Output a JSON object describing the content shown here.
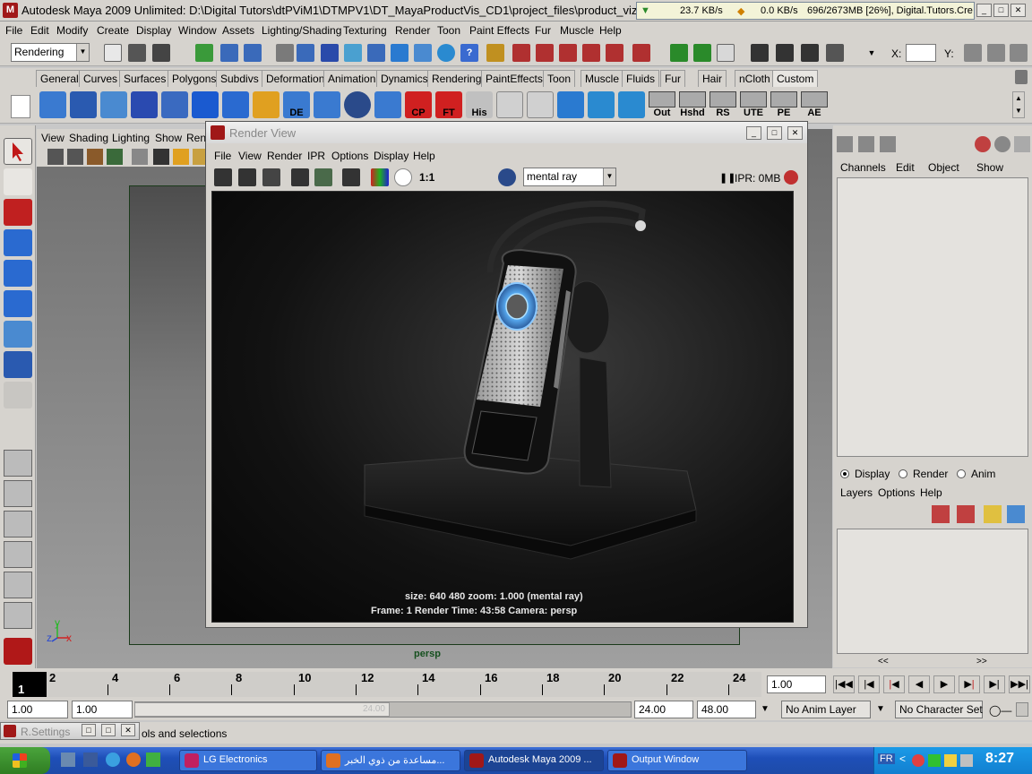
{
  "window": {
    "title": "Autodesk Maya 2009 Unlimited: D:\\Digital Tutors\\dtPViM1\\DTMPV1\\DT_MayaProductVis_CD1\\project_files\\product_viz_proj\\s",
    "net_down": "23.7 KB/s",
    "net_up": "0.0 KB/s",
    "net_info": "696/2673MB [26%], Digital.Tutors.Cre"
  },
  "menubar": [
    "File",
    "Edit",
    "Modify",
    "Create",
    "Display",
    "Window",
    "Assets",
    "Lighting/Shading",
    "Texturing",
    "Render",
    "Toon",
    "Paint Effects",
    "Fur",
    "Muscle",
    "Help"
  ],
  "statusline": {
    "menuset": "Rendering",
    "x_label": "X:",
    "y_label": "Y:"
  },
  "shelf_tabs": [
    "General",
    "Curves",
    "Surfaces",
    "Polygons",
    "Subdivs",
    "Deformation",
    "Animation",
    "Dynamics",
    "Rendering",
    "PaintEffects",
    "Toon",
    "Muscle",
    "Fluids",
    "Fur",
    "Hair",
    "nCloth",
    "Custom"
  ],
  "shelf_labels": {
    "de": "DE",
    "cp": "CP",
    "ft": "FT",
    "his": "His",
    "out": "Out",
    "hshd": "Hshd",
    "rs": "RS",
    "ute": "UTE",
    "pe": "PE",
    "ae": "AE"
  },
  "viewport": {
    "menu": [
      "View",
      "Shading",
      "Lighting",
      "Show",
      "Ren"
    ],
    "camera_label": "persp",
    "axis_y": "y",
    "axis_z": "z",
    "axis_x": "x"
  },
  "render_view": {
    "title": "Render View",
    "menu": [
      "File",
      "View",
      "Render",
      "IPR",
      "Options",
      "Display",
      "Help"
    ],
    "ratio_label": "1:1",
    "renderer": "mental ray",
    "ipr_status": "IPR: 0MB",
    "info_line1": "size:  640  480 zoom: 1.000     (mental ray)",
    "info_line2": "Frame: 1        Render Time: 43:58       Camera: persp"
  },
  "channel_box": {
    "menu": [
      "Channels",
      "Edit",
      "Object",
      "Show"
    ],
    "layer_modes": [
      "Display",
      "Render",
      "Anim"
    ],
    "layer_mode_selected": "Display",
    "layer_menu": [
      "Layers",
      "Options",
      "Help"
    ],
    "nav_left": "<<",
    "nav_right": ">>"
  },
  "time_slider": {
    "current_frame": "1",
    "labels": [
      "2",
      "4",
      "6",
      "8",
      "10",
      "12",
      "14",
      "16",
      "18",
      "20",
      "22",
      "24"
    ],
    "current_time_field": "1.00"
  },
  "range_slider": {
    "start_time": "1.00",
    "playback_start": "1.00",
    "playback_end": "24.00",
    "end_time": "48.00",
    "knob_label": "24.00",
    "anim_layer": "No Anim Layer",
    "character_set": "No Character Set"
  },
  "help_line": {
    "text": "ols and selections",
    "floating_window": "R.Settings"
  },
  "taskbar": {
    "tasks": [
      {
        "label": "LG Electronics",
        "active": false
      },
      {
        "label": "مساعدة من ذوي الخبر...",
        "active": false
      },
      {
        "label": "Autodesk Maya 2009 ...",
        "active": true
      },
      {
        "label": "Output Window",
        "active": false
      }
    ],
    "lang": "FR",
    "clock": "8:27"
  },
  "colors": {
    "ui_grey": "#d6d3ce",
    "maya_red": "#a01818",
    "taskbar_blue": "#245edb",
    "persp_label": "#16501f"
  }
}
